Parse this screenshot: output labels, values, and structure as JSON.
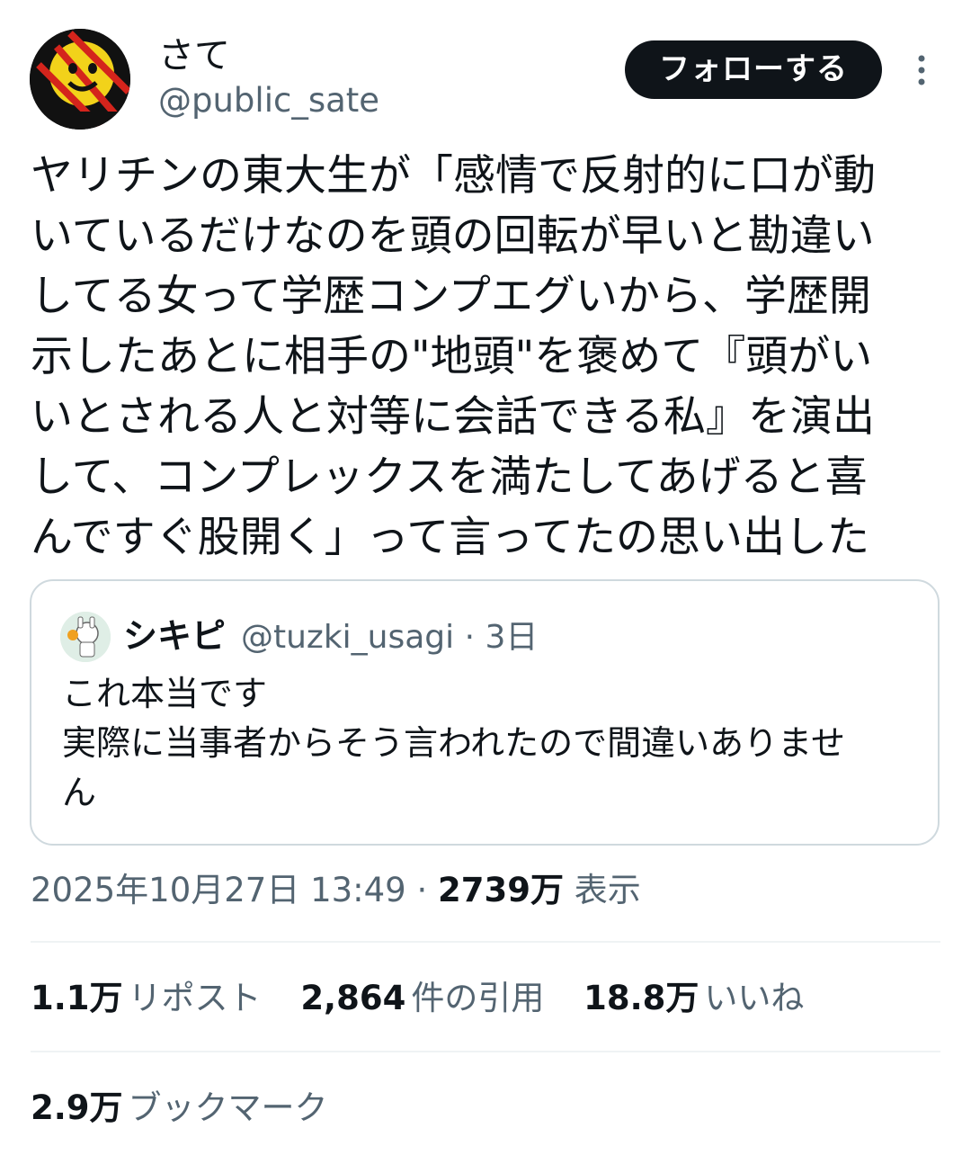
{
  "author": {
    "name": "さて",
    "handle": "@public_sate"
  },
  "header": {
    "follow_label": "フォローする",
    "more_icon": "more-vertical-icon"
  },
  "tweet": {
    "lines": [
      "ヤリチンの東大生が「感情で反射的に口が動",
      "いているだけなのを頭の回転が早いと勘違い",
      "してる女って学歴コンプエグいから、学歴開",
      "示したあとに相手の\"地頭\"を褒めて『頭がい",
      "いとされる人と対等に会話できる私』を演出",
      "して、コンプレックスを満たしてあげると喜",
      "んですぐ股開く」って言ってたの思い出した"
    ]
  },
  "quoted": {
    "name": "シキピ",
    "handle_time": "@tuzki_usagi · 3日",
    "lines": [
      "これ本当です",
      "実際に当事者からそう言われたので間違いありませ",
      "ん"
    ]
  },
  "meta": {
    "datetime": "2025年10月27日 13:49 · ",
    "views_count": "2739万",
    "views_label": " 表示"
  },
  "stats": {
    "reposts": {
      "count": "1.1万",
      "label": "リポスト"
    },
    "quotes": {
      "count": "2,864",
      "label": "件の引用"
    },
    "likes": {
      "count": "18.8万",
      "label": "いいね"
    },
    "bookmarks": {
      "count": "2.9万",
      "label": "ブックマーク"
    }
  },
  "colors": {
    "text": "#0f1419",
    "secondary": "#536471",
    "border": "#cfd9de",
    "follow_bg": "#0f1419"
  }
}
